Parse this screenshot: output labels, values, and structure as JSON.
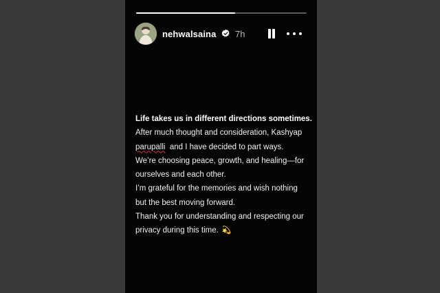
{
  "story": {
    "progress": 0.58,
    "user": {
      "username": "nehwalsaina",
      "verified": true,
      "time_ago": "7h"
    },
    "controls": {
      "pause_icon": "pause-icon",
      "more_icon": "more-horizontal-icon"
    },
    "message": {
      "heading": "Life takes us in different directions sometimes.",
      "line1": "After much thought and consideration, Kashyap",
      "line2_name": "parupalli",
      "line2_rest": "  and I have decided to part ways.",
      "line3": "We’re choosing peace, growth, and healing—for",
      "line4": "ourselves and each other.",
      "line5": "I’m grateful for the memories and wish nothing",
      "line6": "but the best moving forward.",
      "line7": "Thank you for understanding and respecting our",
      "line8": "privacy during this time.",
      "emoji": "💫"
    },
    "colors": {
      "background": "#050505",
      "text": "#f0f0f0",
      "spellcheck_underline": "#d43a3a",
      "outer_backdrop": "#393939"
    }
  }
}
